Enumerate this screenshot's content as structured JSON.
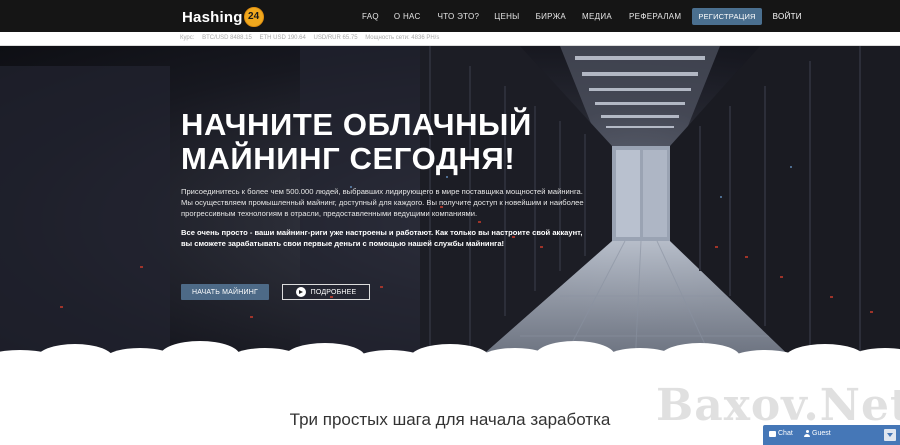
{
  "header": {
    "logo_text": "Hashing",
    "logo_badge": "24",
    "nav": [
      "FAQ",
      "О НАС",
      "ЧТО ЭТО?",
      "ЦЕНЫ",
      "БИРЖА",
      "МЕДИА",
      "РЕФЕРАЛАМ"
    ],
    "register_label": "РЕГИСТРАЦИЯ",
    "login_label": "ВОЙТИ"
  },
  "rates": {
    "label": "Курс:",
    "btc": "BTC/USD 8488.15",
    "eth": "ETH USD 190.64",
    "usdrub": "USD/RUR 65.75",
    "power": "Мощность сети: 4836 PH/s"
  },
  "hero": {
    "title_line1": "НАЧНИТЕ ОБЛАЧНЫЙ",
    "title_line2": "МАЙНИНГ СЕГОДНЯ!",
    "paragraph1": "Присоединитесь к более чем 500.000 людей, выбравших лидирующего в мире поставщика мощностей майнинга. Мы осуществляем промышленный майнинг, доступный для каждого. Вы получите доступ к новейшим и наиболее прогрессивным технологиям в отрасли, предоставленными ведущими компаниями.",
    "paragraph2": "Все очень просто - ваши майнинг-риги уже настроены и работают. Как только вы настроите свой аккаунт, вы сможете зарабатывать свои первые деньги с помощью нашей службы майнинга!",
    "start_button": "НАЧАТЬ МАЙНИНГ",
    "more_button": "ПОДРОБНЕЕ"
  },
  "steps_title": "Три простых шага для начала заработка",
  "watermark": "Baxov.Net",
  "chat_widget": {
    "chat_label": "Chat",
    "guest_label": "Guest"
  },
  "colors": {
    "nav_bg": "#151515",
    "accent": "#4a6f8f",
    "logo_badge": "#f0a81e",
    "chat_bg": "#4577b7"
  }
}
